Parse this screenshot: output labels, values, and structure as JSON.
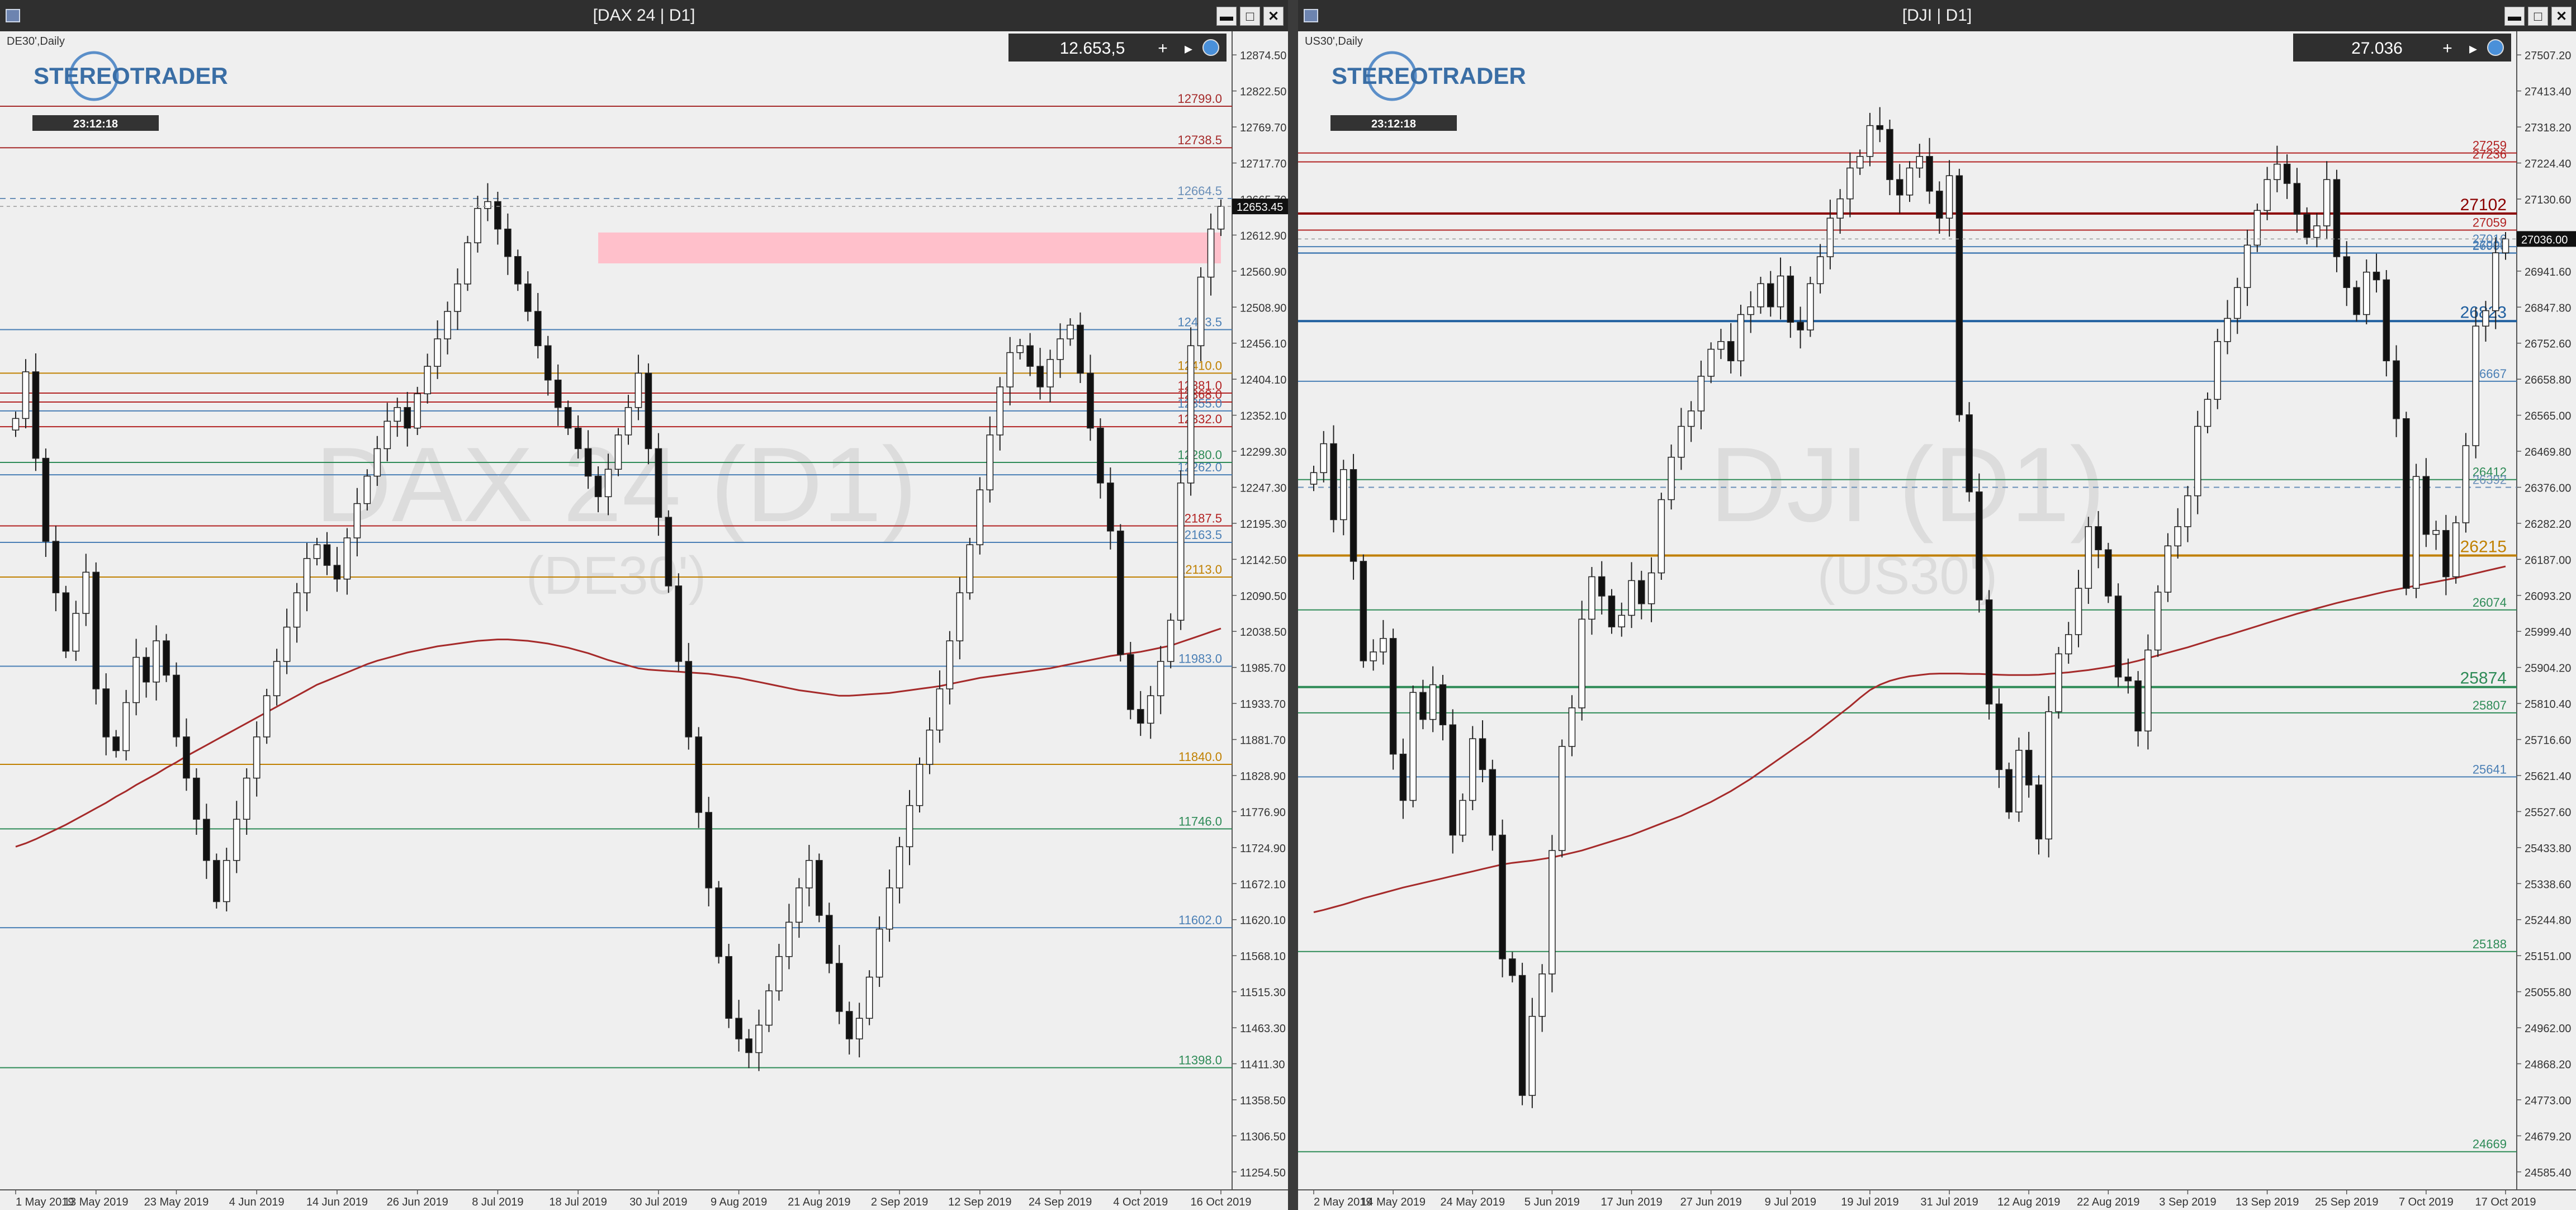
{
  "left": {
    "window_title": "[DAX 24 | D1]",
    "symbol_caption": "DE30',Daily",
    "logo_text": "STEREOTRADER",
    "timer": "23:12:18",
    "price_box": "12.653,5",
    "watermark_main": "DAX 24 (D1)",
    "watermark_sub": "(DE30')",
    "current_price_label": "12653.45",
    "ma_color": "#a52a2a",
    "y_range": [
      11220,
      12900
    ],
    "x_range": [
      0,
      120
    ],
    "y_ticks": [
      "12874.50",
      "12822.50",
      "12769.70",
      "12717.70",
      "12665.70",
      "12612.90",
      "12560.90",
      "12508.90",
      "12456.10",
      "12404.10",
      "12352.10",
      "12299.30",
      "12247.30",
      "12195.30",
      "12142.50",
      "12090.50",
      "12038.50",
      "11985.70",
      "11933.70",
      "11881.70",
      "11828.90",
      "11776.90",
      "11724.90",
      "11672.10",
      "11620.10",
      "11568.10",
      "11515.30",
      "11463.30",
      "11411.30",
      "11358.50",
      "11306.50",
      "11254.50"
    ],
    "x_ticks": [
      {
        "label": "1 May 2019",
        "i": 0
      },
      {
        "label": "13 May 2019",
        "i": 8
      },
      {
        "label": "23 May 2019",
        "i": 16
      },
      {
        "label": "4 Jun 2019",
        "i": 24
      },
      {
        "label": "14 Jun 2019",
        "i": 32
      },
      {
        "label": "26 Jun 2019",
        "i": 40
      },
      {
        "label": "8 Jul 2019",
        "i": 48
      },
      {
        "label": "18 Jul 2019",
        "i": 56
      },
      {
        "label": "30 Jul 2019",
        "i": 64
      },
      {
        "label": "9 Aug 2019",
        "i": 72
      },
      {
        "label": "21 Aug 2019",
        "i": 80
      },
      {
        "label": "2 Sep 2019",
        "i": 88
      },
      {
        "label": "12 Sep 2019",
        "i": 96
      },
      {
        "label": "24 Sep 2019",
        "i": 104
      },
      {
        "label": "4 Oct 2019",
        "i": 112
      },
      {
        "label": "16 Oct 2019",
        "i": 120
      }
    ],
    "levels": [
      {
        "value": 12799.0,
        "label": "12799.0",
        "color": "#a52a2a"
      },
      {
        "value": 12738.5,
        "label": "12738.5",
        "color": "#a52a2a"
      },
      {
        "value": 12664.5,
        "label": "12664.5",
        "color": "#6a8fb8",
        "dashed": true
      },
      {
        "value": 12473.5,
        "label": "12473.5",
        "color": "#4a7fb5"
      },
      {
        "value": 12410.0,
        "label": "12410.0",
        "color": "#c08000"
      },
      {
        "value": 12381.0,
        "label": "12381.0",
        "color": "#b22222"
      },
      {
        "value": 12368.0,
        "label": "12368.0",
        "color": "#b22222"
      },
      {
        "value": 12355.0,
        "label": "12355.0",
        "color": "#4a7fb5"
      },
      {
        "value": 12332.0,
        "label": "12332.0",
        "color": "#b22222"
      },
      {
        "value": 12280.0,
        "label": "12280.0",
        "color": "#2e8b57"
      },
      {
        "value": 12262.0,
        "label": "12262.0",
        "color": "#4a7fb5"
      },
      {
        "value": 12187.5,
        "label": "12187.5",
        "color": "#b22222"
      },
      {
        "value": 12163.5,
        "label": "12163.5",
        "color": "#4a7fb5"
      },
      {
        "value": 12113.0,
        "label": "12113.0",
        "color": "#c08000"
      },
      {
        "value": 11983.0,
        "label": "11983.0",
        "color": "#4a7fb5"
      },
      {
        "value": 11840.0,
        "label": "11840.0",
        "color": "#c08000"
      },
      {
        "value": 11746.0,
        "label": "11746.0",
        "color": "#2e8b57"
      },
      {
        "value": 11602.0,
        "label": "11602.0",
        "color": "#4a7fb5"
      },
      {
        "value": 11398.0,
        "label": "11398.0",
        "color": "#2e8b57"
      }
    ],
    "zone": {
      "from_i": 58,
      "to_i": 120,
      "low": 12570,
      "high": 12615,
      "color": "#ffc0cb"
    },
    "closes": [
      12344,
      12412,
      12286,
      12165,
      12090,
      12005,
      12060,
      12120,
      11950,
      11880,
      11860,
      11930,
      11996,
      11960,
      12020,
      11970,
      11880,
      11820,
      11760,
      11700,
      11640,
      11700,
      11760,
      11820,
      11880,
      11940,
      11990,
      12040,
      12090,
      12140,
      12160,
      12130,
      12110,
      12170,
      12220,
      12260,
      12300,
      12340,
      12360,
      12330,
      12380,
      12420,
      12460,
      12500,
      12540,
      12600,
      12650,
      12660,
      12620,
      12580,
      12540,
      12500,
      12450,
      12400,
      12360,
      12330,
      12300,
      12260,
      12230,
      12270,
      12320,
      12360,
      12410,
      12300,
      12200,
      12100,
      11990,
      11880,
      11770,
      11660,
      11560,
      11470,
      11440,
      11420,
      11460,
      11510,
      11560,
      11610,
      11660,
      11700,
      11620,
      11550,
      11480,
      11440,
      11470,
      11530,
      11600,
      11660,
      11720,
      11780,
      11840,
      11890,
      11950,
      12020,
      12090,
      12160,
      12240,
      12320,
      12390,
      12440,
      12450,
      12420,
      12390,
      12430,
      12460,
      12480,
      12410,
      12330,
      12250,
      12180,
      12000,
      11920,
      11900,
      11940,
      11990,
      12050,
      12250,
      12450,
      12550,
      12620,
      12653
    ],
    "ma": [
      11720,
      11725,
      11731,
      11738,
      11745,
      11752,
      11760,
      11768,
      11776,
      11784,
      11793,
      11801,
      11810,
      11818,
      11826,
      11835,
      11843,
      11852,
      11860,
      11868,
      11876,
      11884,
      11892,
      11900,
      11908,
      11916,
      11924,
      11932,
      11940,
      11948,
      11956,
      11962,
      11968,
      11974,
      11980,
      11986,
      11991,
      11995,
      11999,
      12003,
      12006,
      12009,
      12012,
      12014,
      12016,
      12018,
      12020,
      12021,
      12022,
      12022,
      12021,
      12020,
      12018,
      12016,
      12013,
      12010,
      12006,
      12002,
      11997,
      11992,
      11988,
      11984,
      11980,
      11978,
      11977,
      11976,
      11975,
      11974,
      11973,
      11972,
      11970,
      11968,
      11966,
      11963,
      11960,
      11957,
      11954,
      11951,
      11948,
      11946,
      11944,
      11942,
      11940,
      11940,
      11941,
      11942,
      11943,
      11944,
      11946,
      11948,
      11950,
      11952,
      11954,
      11957,
      11960,
      11963,
      11966,
      11968,
      11970,
      11972,
      11974,
      11976,
      11978,
      11980,
      11983,
      11986,
      11989,
      11992,
      11995,
      11998,
      12000,
      12002,
      12004,
      12007,
      12010,
      12013,
      12018,
      12023,
      12028,
      12033,
      12038
    ]
  },
  "right": {
    "window_title": "[DJI | D1]",
    "symbol_caption": "US30',Daily",
    "logo_text": "STEREOTRADER",
    "timer": "23:12:18",
    "price_box": "27.036",
    "watermark_main": "DJI (D1)",
    "watermark_sub": "(US30')",
    "current_price_label": "27036.00",
    "ma_color": "#a52a2a",
    "y_range": [
      24570,
      27560
    ],
    "x_range": [
      0,
      120
    ],
    "y_ticks": [
      "27507.20",
      "27413.40",
      "27318.20",
      "27224.40",
      "27130.60",
      "27035.40",
      "26941.60",
      "26847.80",
      "26752.60",
      "26658.80",
      "26565.00",
      "26469.80",
      "26376.00",
      "26282.20",
      "26187.00",
      "26093.20",
      "25999.40",
      "25904.20",
      "25810.40",
      "25716.60",
      "25621.40",
      "25527.60",
      "25433.80",
      "25338.60",
      "25244.80",
      "25151.00",
      "25055.80",
      "24962.00",
      "24868.20",
      "24773.00",
      "24679.20",
      "24585.40"
    ],
    "x_ticks": [
      {
        "label": "2 May 2019",
        "i": 0
      },
      {
        "label": "14 May 2019",
        "i": 8
      },
      {
        "label": "24 May 2019",
        "i": 16
      },
      {
        "label": "5 Jun 2019",
        "i": 24
      },
      {
        "label": "17 Jun 2019",
        "i": 32
      },
      {
        "label": "27 Jun 2019",
        "i": 40
      },
      {
        "label": "9 Jul 2019",
        "i": 48
      },
      {
        "label": "19 Jul 2019",
        "i": 56
      },
      {
        "label": "31 Jul 2019",
        "i": 64
      },
      {
        "label": "12 Aug 2019",
        "i": 72
      },
      {
        "label": "22 Aug 2019",
        "i": 80
      },
      {
        "label": "3 Sep 2019",
        "i": 88
      },
      {
        "label": "13 Sep 2019",
        "i": 96
      },
      {
        "label": "25 Sep 2019",
        "i": 104
      },
      {
        "label": "7 Oct 2019",
        "i": 112
      },
      {
        "label": "17 Oct 2019",
        "i": 120
      }
    ],
    "levels": [
      {
        "value": 27259,
        "label": "27259",
        "color": "#b22222"
      },
      {
        "value": 27236,
        "label": "27236",
        "color": "#b22222"
      },
      {
        "value": 27102,
        "label": "27102",
        "color": "#8b0000",
        "bold": true
      },
      {
        "value": 27059,
        "label": "27059",
        "color": "#b22222"
      },
      {
        "value": 27016,
        "label": "27016",
        "color": "#4a7fb5"
      },
      {
        "value": 27000,
        "label": "27000",
        "color": "#4a7fb5"
      },
      {
        "value": 26999,
        "label": "26999",
        "color": "#4a7fb5"
      },
      {
        "value": 26823,
        "label": "26823",
        "color": "#1f5f9f",
        "bold": true
      },
      {
        "value": 26667,
        "label": "26667",
        "color": "#4a7fb5"
      },
      {
        "value": 26412,
        "label": "26412",
        "color": "#2e8b57"
      },
      {
        "value": 26392,
        "label": "26392",
        "color": "#6a8fb8",
        "dashed": true
      },
      {
        "value": 26215,
        "label": "26215",
        "color": "#c08000",
        "bold": true
      },
      {
        "value": 26074,
        "label": "26074",
        "color": "#2e8b57"
      },
      {
        "value": 25874,
        "label": "25874",
        "color": "#2e8b57",
        "bold": true
      },
      {
        "value": 25807,
        "label": "25807",
        "color": "#2e8b57"
      },
      {
        "value": 25641,
        "label": "25641",
        "color": "#4a7fb5"
      },
      {
        "value": 25188,
        "label": "25188",
        "color": "#2e8b57"
      },
      {
        "value": 24669,
        "label": "24669",
        "color": "#2e8b57"
      }
    ],
    "closes": [
      26430,
      26505,
      26308,
      26438,
      26200,
      25942,
      25965,
      26000,
      25700,
      25580,
      25860,
      25790,
      25880,
      25776,
      25490,
      25580,
      25740,
      25660,
      25490,
      25169,
      25126,
      24815,
      25020,
      25130,
      25450,
      25720,
      25820,
      26050,
      26160,
      26110,
      26030,
      26060,
      26150,
      26090,
      26170,
      26360,
      26470,
      26550,
      26590,
      26680,
      26750,
      26770,
      26720,
      26840,
      26860,
      26920,
      26860,
      26940,
      26820,
      26800,
      26920,
      26990,
      27090,
      27140,
      27220,
      27250,
      27330,
      27320,
      27190,
      27150,
      27220,
      27250,
      27160,
      27090,
      27200,
      26580,
      26380,
      26100,
      25830,
      25660,
      25550,
      25710,
      25620,
      25480,
      25810,
      25960,
      26010,
      26130,
      26290,
      26230,
      26110,
      25900,
      25890,
      25760,
      25970,
      26120,
      26240,
      26290,
      26370,
      26550,
      26620,
      26770,
      26830,
      26910,
      27020,
      27110,
      27190,
      27230,
      27180,
      27100,
      27040,
      27070,
      27190,
      26990,
      26910,
      26840,
      26950,
      26930,
      26720,
      26570,
      26130,
      26420,
      26270,
      26280,
      26160,
      26300,
      26500,
      26810,
      26850,
      27000,
      27036
    ],
    "ma": [
      25290,
      25296,
      25303,
      25310,
      25318,
      25326,
      25333,
      25340,
      25347,
      25354,
      25360,
      25366,
      25372,
      25378,
      25384,
      25390,
      25396,
      25402,
      25408,
      25414,
      25418,
      25421,
      25424,
      25428,
      25432,
      25438,
      25444,
      25450,
      25458,
      25466,
      25474,
      25482,
      25490,
      25500,
      25510,
      25520,
      25530,
      25540,
      25552,
      25564,
      25576,
      25590,
      25604,
      25620,
      25636,
      25654,
      25672,
      25690,
      25708,
      25726,
      25744,
      25764,
      25784,
      25804,
      25824,
      25846,
      25866,
      25880,
      25890,
      25897,
      25902,
      25905,
      25908,
      25909,
      25909,
      25909,
      25908,
      25908,
      25907,
      25906,
      25905,
      25905,
      25905,
      25906,
      25908,
      25910,
      25912,
      25915,
      25918,
      25922,
      25926,
      25931,
      25936,
      25942,
      25949,
      25956,
      25963,
      25970,
      25977,
      25985,
      25993,
      26001,
      26008,
      26016,
      26024,
      26032,
      26040,
      26048,
      26056,
      26064,
      26071,
      26078,
      26085,
      26092,
      26098,
      26104,
      26110,
      26116,
      26122,
      26127,
      26132,
      26137,
      26142,
      26147,
      26152,
      26157,
      26163,
      26169,
      26175,
      26181,
      26187
    ]
  },
  "window_controls": {
    "minimize": "▬",
    "maximize": "□",
    "close": "✕"
  }
}
